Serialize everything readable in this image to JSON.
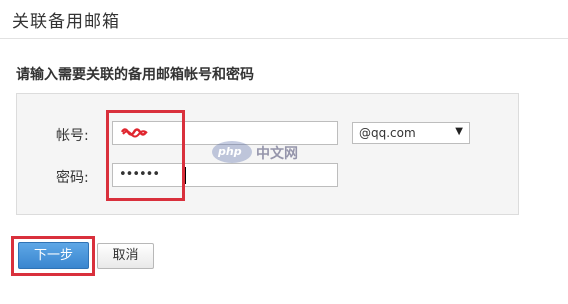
{
  "page": {
    "title": "关联备用邮箱",
    "section_heading": "请输入需要关联的备用邮箱帐号和密码"
  },
  "form": {
    "account_label": "帐号:",
    "account_value": "",
    "password_label": "密码:",
    "password_value": "••••••",
    "domain_select": {
      "selected": "@qq.com",
      "arrow": "▼"
    }
  },
  "buttons": {
    "next_label": "下一步",
    "cancel_label": "取消"
  },
  "watermark": {
    "logo_text": "php",
    "text": "中文网"
  },
  "colors": {
    "highlight": "#d9303c",
    "primary_button": "#3a86cf",
    "panel_background": "#f5f5f5"
  }
}
